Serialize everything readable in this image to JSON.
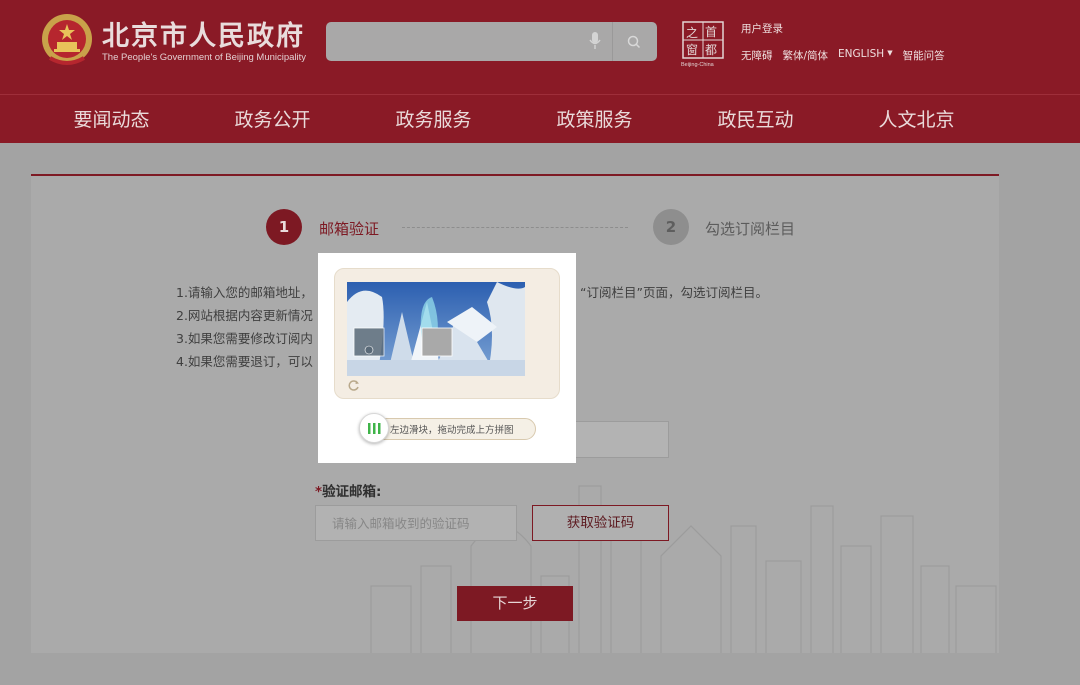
{
  "header": {
    "logo_cn": "北京市人民政府",
    "logo_en": "The People's Government of Beijing Municipality",
    "search_placeholder": "",
    "capital_logo_text": "首都之窗",
    "capital_logo_sub": "Beijing-China",
    "user_login": "用户登录",
    "links": [
      "无障碍",
      "繁体/简体",
      "ENGLISH",
      "智能问答"
    ]
  },
  "nav": {
    "items": [
      "要闻动态",
      "政务公开",
      "政务服务",
      "政策服务",
      "政民互动",
      "人文北京"
    ]
  },
  "steps": [
    {
      "number": "1",
      "label": "邮箱验证"
    },
    {
      "number": "2",
      "label": "勾选订阅栏目"
    }
  ],
  "instructions": [
    "1.请输入您的邮箱地址，",
    "2.网站根据内容更新情况",
    "3.如果您需要修改订阅内",
    "4.如果您需要退订，可以"
  ],
  "instructions_right": "“订阅栏目”页面，勾选订阅栏目。",
  "form": {
    "verify_label_star": "*",
    "verify_label": "验证邮箱:",
    "code_placeholder": "请输入邮箱收到的验证码",
    "get_code_label": "获取验证码",
    "next_label": "下一步"
  },
  "captcha": {
    "slider_hint": "左边滑块，拖动完成上方拼图",
    "slider_progress": 0
  },
  "colors": {
    "brand": "#8a1a26",
    "accent": "#7d1923"
  }
}
